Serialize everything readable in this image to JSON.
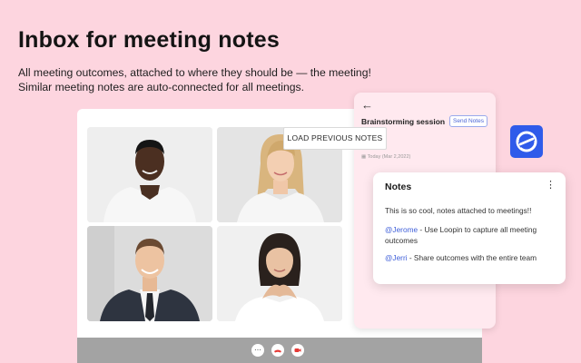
{
  "headline": "Inbox for meeting notes",
  "subheadline": {
    "line1": "All meeting outcomes, attached to where they should be — the meeting!",
    "line2": "Similar meeting notes are auto-connected for all meetings."
  },
  "panel": {
    "session_title": "Brainstorming session",
    "send_notes_label": "Send Notes",
    "date_text": "Today (Mar 2,2022)"
  },
  "load_previous_label": "LOAD PREVIOUS NOTES",
  "notes_card": {
    "title": "Notes",
    "line1": "This is so cool, notes attached to meetings!!",
    "mention1": "@Jerome",
    "text1": " - Use Loopin to capture all meeting outcomes",
    "mention2": "@Jerri",
    "text2": " - Share outcomes with the entire team"
  },
  "icons": {
    "back": "arrow-left-icon",
    "more": "more-vertical-icon",
    "logo": "loopin-logo-icon",
    "call_more": "more-horizontal-icon",
    "end_call": "phone-end-icon",
    "video": "video-icon"
  },
  "colors": {
    "background": "#fdd5df",
    "brand_blue": "#2f5bea",
    "mention": "#3f5fd9",
    "end_call": "#e53935"
  }
}
